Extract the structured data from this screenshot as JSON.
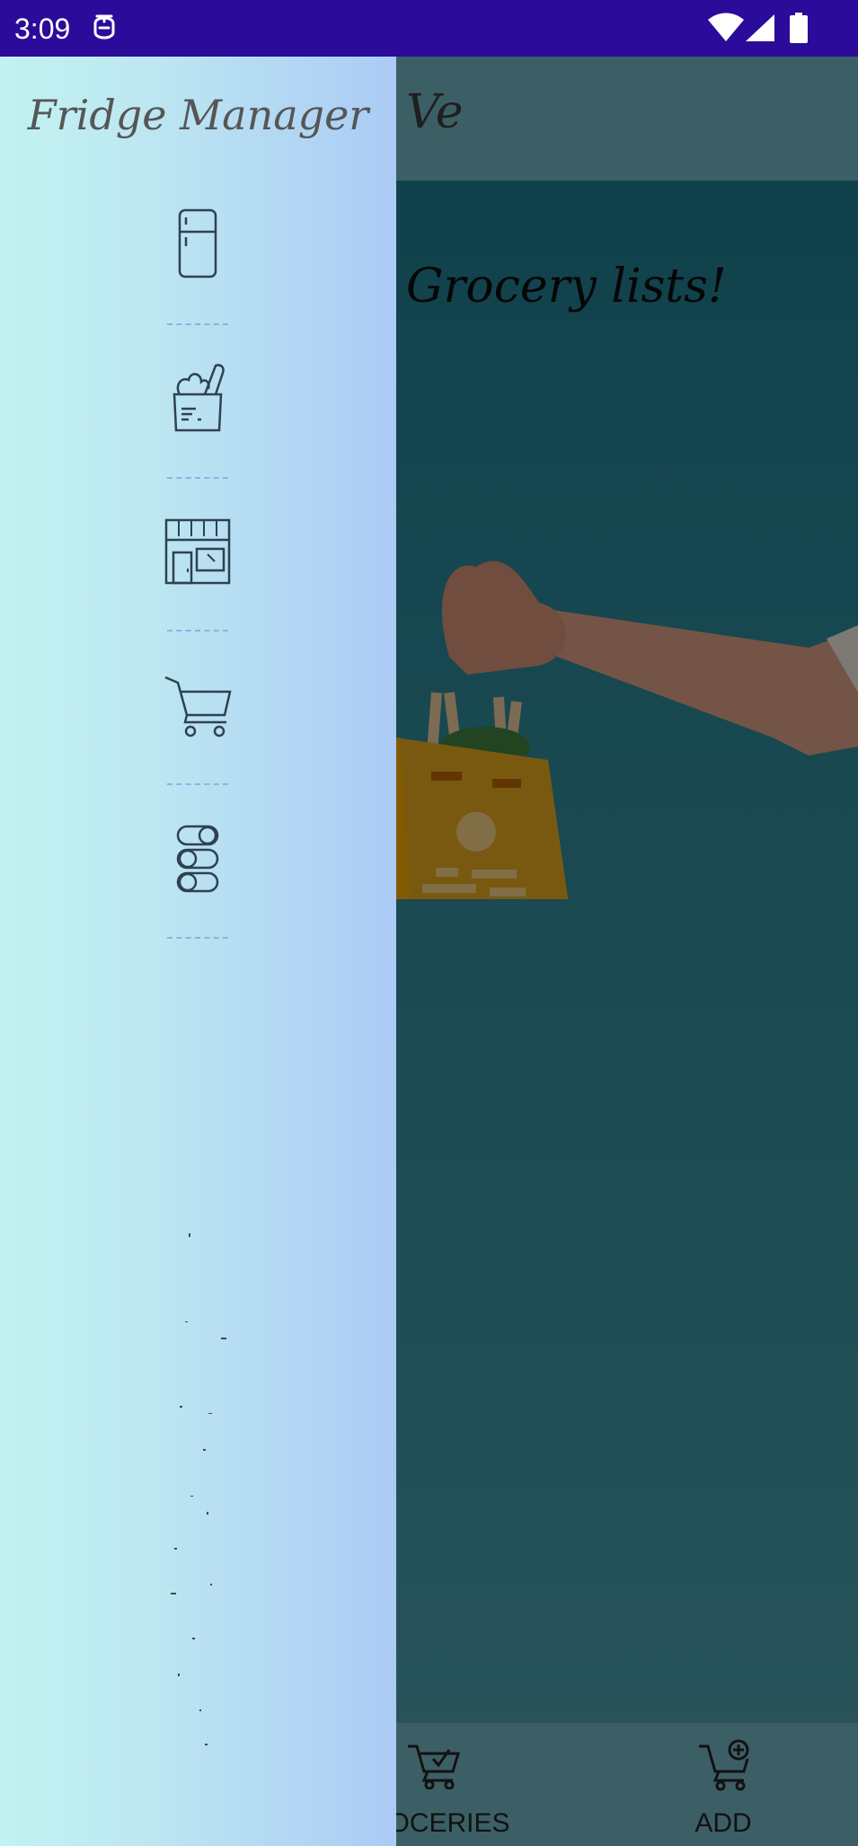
{
  "status_bar": {
    "time": "3:09",
    "icons": [
      "data-saver-icon",
      "wifi-icon",
      "cellular-signal-icon",
      "battery-icon"
    ]
  },
  "toolbar": {
    "title_fragment": "Ve"
  },
  "content": {
    "heading_fragment": "Grocery lists!"
  },
  "bottom_nav": {
    "items": [
      {
        "label": "OCERIES",
        "icon": "cart-check-icon"
      },
      {
        "label": "ADD",
        "icon": "cart-add-icon"
      }
    ]
  },
  "drawer": {
    "title": "Fridge Manager",
    "items": [
      {
        "icon": "fridge-icon"
      },
      {
        "icon": "grocery-bag-icon"
      },
      {
        "icon": "store-icon"
      },
      {
        "icon": "shopping-cart-icon"
      },
      {
        "icon": "toggle-settings-icon"
      }
    ]
  },
  "colors": {
    "status_bar": "#2a0b9a",
    "drawer_start": "#c2f2f1",
    "drawer_end": "#abcbf6",
    "toolbar": "#6fb0bb",
    "content": "#1f7a8c",
    "icon_stroke": "#2f4150",
    "bag": "#e0a51e"
  }
}
